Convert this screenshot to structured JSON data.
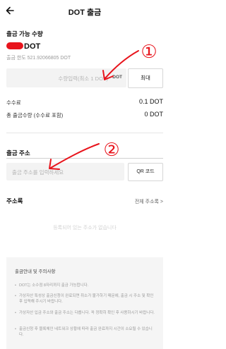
{
  "header": {
    "title": "DOT 출금"
  },
  "available": {
    "label": "출금 가능 수량",
    "amount": "",
    "unit": "DOT",
    "limit": "출금 한도 521.92066805 DOT"
  },
  "amount_input": {
    "placeholder": "수량입력(최소 1 DOT)",
    "unit": "DOT",
    "max_label": "최대"
  },
  "fee": {
    "label": "수수료",
    "value": "0.1 DOT"
  },
  "total": {
    "label": "총 출금수량 (수수료 포함)",
    "value": "0 DOT"
  },
  "address": {
    "label": "출금 주소",
    "placeholder": "출금 주소를 입력하세요",
    "qr_label": "QR 코드"
  },
  "address_book": {
    "label": "주소록",
    "link": "전체 주소록 >",
    "empty": "등록되어 있는 주소가 없습니다"
  },
  "notice": {
    "title": "출금안내 및 주의사항",
    "items": [
      "DOT는 소수점 8자리까지 출금 가능합니다.",
      "가상자산 특성상 출금신청이 완료되면 취소가 불가하기 때문에, 출금 시 주소 및 확인 후 입력해 주시기 바랍니다.",
      "가상자산 입금 주소와 출금 주소는 다릅니다. 꼭 정확히 확인 후 사용하시기 바랍니다.",
      "출금신청 후 블록체인 네트워크 상황에 따라 출금 완료까지 시간이 소요될 수 있습니다."
    ]
  },
  "annotations": {
    "mark_1": "①",
    "mark_2": "②",
    "color": "#e8141c"
  }
}
